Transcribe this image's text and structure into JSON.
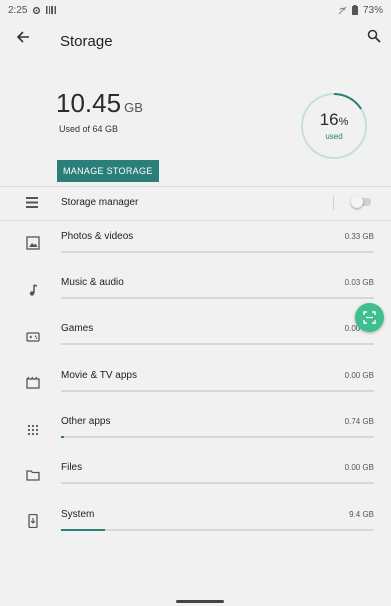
{
  "status": {
    "time": "2:25",
    "battery": "73%"
  },
  "appbar": {
    "title": "Storage"
  },
  "summary": {
    "used_value": "10.45",
    "used_unit": "GB",
    "used_of": "Used of 64 GB",
    "manage_label": "MANAGE STORAGE",
    "percent_value": "16",
    "percent_sign": "%",
    "percent_label": "used",
    "percent_fraction": 0.16
  },
  "storage_manager": {
    "label": "Storage manager",
    "enabled": false
  },
  "categories": [
    {
      "label": "Photos & videos",
      "size": "0.33 GB",
      "fraction": 0.0
    },
    {
      "label": "Music & audio",
      "size": "0.03 GB",
      "fraction": 0.0
    },
    {
      "label": "Games",
      "size": "0.00 GB",
      "fraction": 0.0
    },
    {
      "label": "Movie & TV apps",
      "size": "0.00 GB",
      "fraction": 0.0
    },
    {
      "label": "Other apps",
      "size": "0.74 GB",
      "fraction": 0.01
    },
    {
      "label": "Files",
      "size": "0.00 GB",
      "fraction": 0.0
    },
    {
      "label": "System",
      "size": "9.4 GB",
      "fraction": 0.14
    }
  ],
  "colors": {
    "accent": "#2a8078",
    "fab": "#3fbf8f",
    "track": "#d7d7d7",
    "background": "#f1f1f1"
  }
}
